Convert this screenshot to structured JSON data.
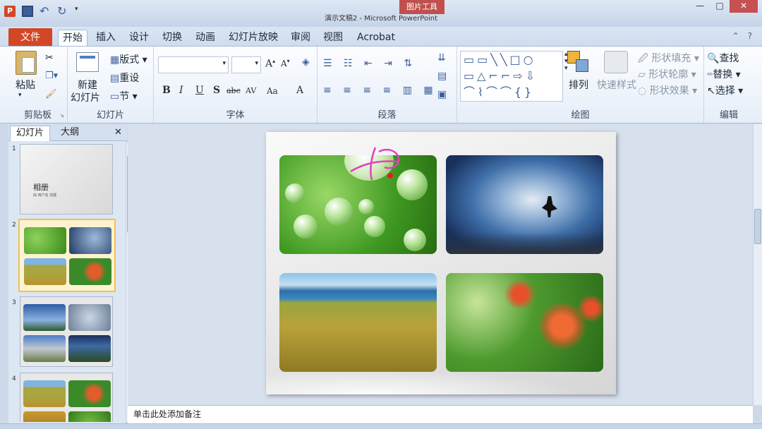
{
  "window": {
    "title": "演示文稿2 - Microsoft PowerPoint",
    "app_badge": "P",
    "context_tab": "图片工具",
    "minimize": "—",
    "maximize": "□",
    "close": "✕"
  },
  "tabs": [
    "文件",
    "开始",
    "插入",
    "设计",
    "切换",
    "动画",
    "幻灯片放映",
    "审阅",
    "视图",
    "Acrobat"
  ],
  "active_tab": "开始",
  "ribbon": {
    "clipboard": {
      "label": "剪贴板",
      "paste": "粘贴"
    },
    "slides": {
      "label": "幻灯片",
      "new_slide": "新建",
      "new_slide_2": "幻灯片",
      "layout": "版式",
      "reset": "重设",
      "section": "节"
    },
    "font": {
      "label": "字体",
      "font_name": "",
      "font_size": "",
      "bold": "B",
      "italic": "I",
      "underline": "U",
      "shadow": "S",
      "strike": "abc",
      "spacing": "AV",
      "case": "Aa",
      "color": "A"
    },
    "paragraph": {
      "label": "段落"
    },
    "drawing": {
      "label": "绘图",
      "arrange": "排列",
      "quick_styles": "快速样式",
      "shape_fill": "形状填充",
      "shape_outline": "形状轮廓",
      "shape_effects": "形状效果"
    },
    "editing": {
      "label": "编辑",
      "find": "查找",
      "replace": "替换",
      "select": "选择"
    }
  },
  "pane": {
    "tab_slides": "幻灯片",
    "tab_outline": "大纲",
    "close": "✕",
    "slides": [
      {
        "num": "1",
        "title": "相册",
        "subtitle": "由 用户名 创建"
      },
      {
        "num": "2"
      },
      {
        "num": "3"
      },
      {
        "num": "4"
      }
    ]
  },
  "notes_placeholder": "单击此处添加备注",
  "colors": {
    "file_tab": "#d24726",
    "accent": "#3b5f9b",
    "selected_thumb": "#f2c14e",
    "ink": "#e040c0"
  }
}
